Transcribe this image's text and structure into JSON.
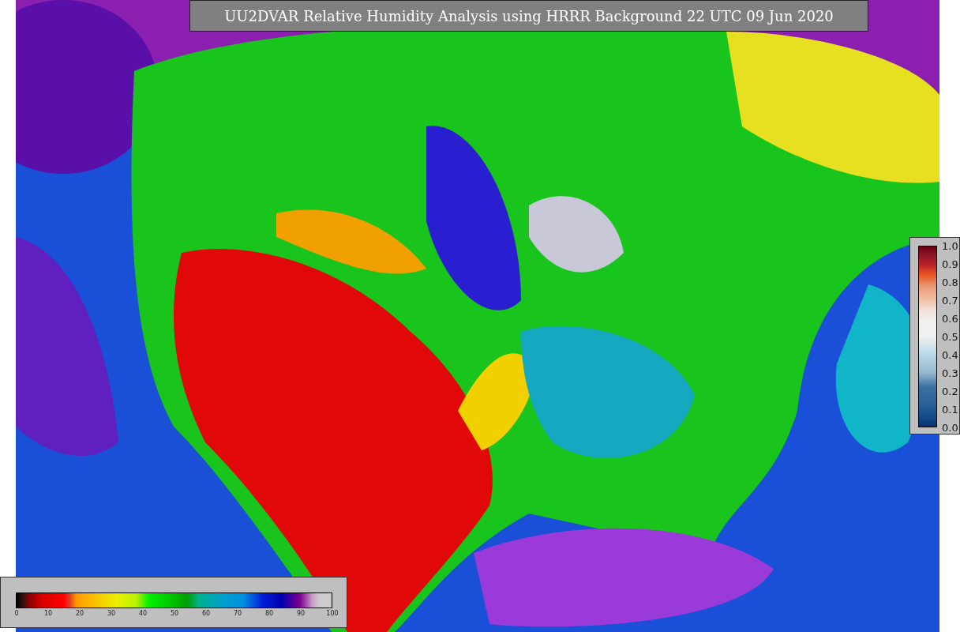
{
  "title": "UU2DVAR Relative Humidity Analysis using HRRR Background 22 UTC 09 Jun 2020",
  "humidity_legend": {
    "ticks": [
      "0",
      "10",
      "20",
      "30",
      "40",
      "50",
      "60",
      "70",
      "80",
      "90",
      "100"
    ]
  },
  "observation_legend": {
    "ticks": [
      "1.0",
      "0.9",
      "0.8",
      "0.7",
      "0.6",
      "0.5",
      "0.4",
      "0.3",
      "0.2",
      "0.1",
      "0.0"
    ]
  }
}
